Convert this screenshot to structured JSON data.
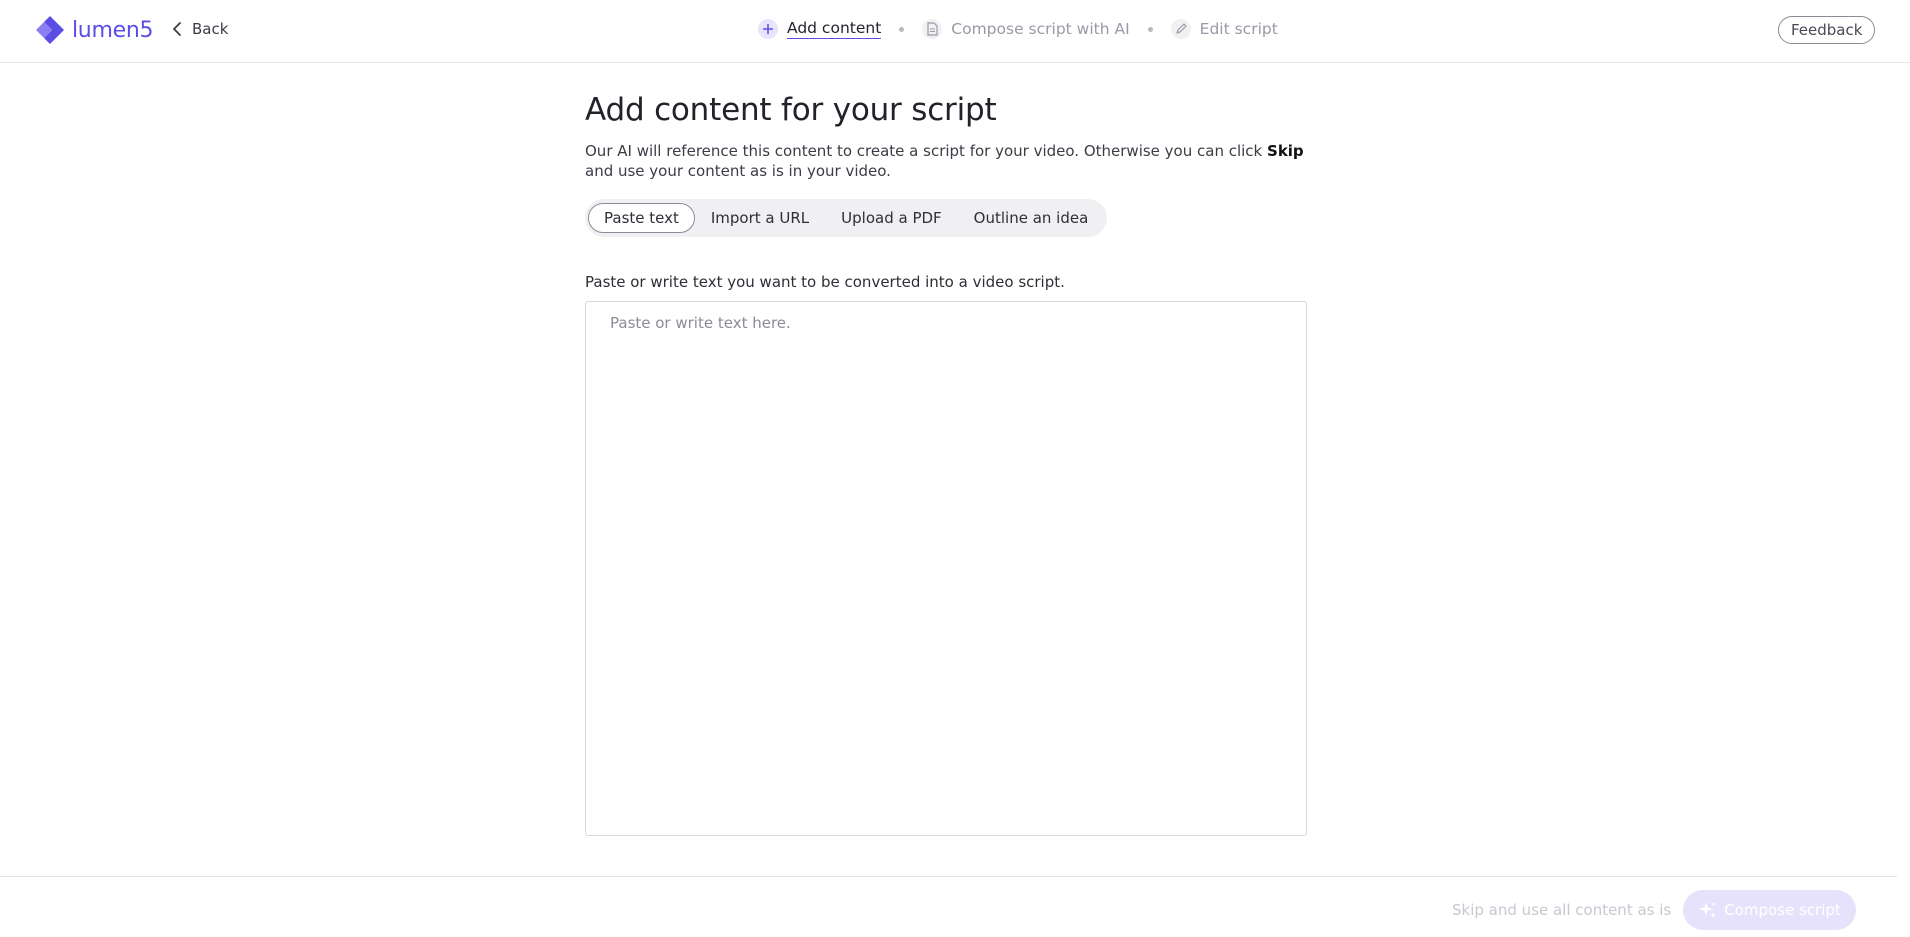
{
  "brand": {
    "name": "lumen5",
    "color": "#5b4ee6"
  },
  "header": {
    "back_label": "Back",
    "steps": [
      {
        "label": "Add content",
        "icon": "plus-icon",
        "state": "active"
      },
      {
        "label": "Compose script with AI",
        "icon": "document-icon",
        "state": "inactive"
      },
      {
        "label": "Edit script",
        "icon": "pencil-icon",
        "state": "inactive"
      }
    ],
    "feedback_label": "Feedback"
  },
  "main": {
    "title": "Add content for your script",
    "description_before": "Our AI will reference this content to create a script for your video. Otherwise you can click ",
    "description_bold": "Skip",
    "description_after": " and use your content as is in your video.",
    "tabs": [
      {
        "label": "Paste text",
        "selected": true
      },
      {
        "label": "Import a URL",
        "selected": false
      },
      {
        "label": "Upload a PDF",
        "selected": false
      },
      {
        "label": "Outline an idea",
        "selected": false
      }
    ],
    "field_label": "Paste or write text you want to be converted into a video script.",
    "textarea_value": "",
    "textarea_placeholder": "Paste or write text here."
  },
  "footer": {
    "skip_label": "Skip and use all content as is",
    "compose_label": "Compose script",
    "compose_icon": "sparkle-icon",
    "compose_disabled": true
  }
}
